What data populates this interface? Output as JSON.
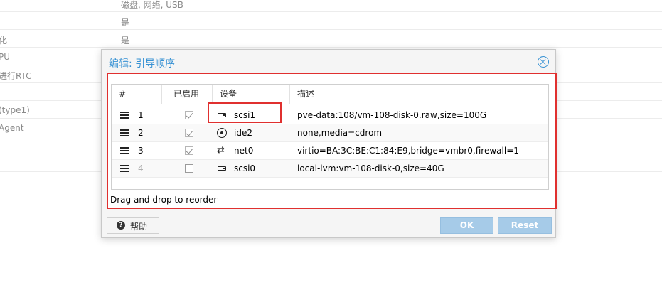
{
  "background": {
    "rows": [
      {
        "key": "",
        "value": "磁盘, 网络, USB"
      },
      {
        "key": "",
        "value": "是"
      },
      {
        "key": "化",
        "value": "是"
      },
      {
        "key": "PU",
        "value": ""
      },
      {
        "key": "进行RTC",
        "value": ""
      },
      {
        "key": "",
        "value": ""
      },
      {
        "key": "(type1)",
        "value": ""
      },
      {
        "key": "Agent",
        "value": ""
      },
      {
        "key": "",
        "value": ""
      },
      {
        "key": "",
        "value": ""
      }
    ]
  },
  "dialog": {
    "title": "编辑: 引导顺序",
    "columns": {
      "order": "#",
      "enabled": "已启用",
      "device": "设备",
      "description": "描述"
    },
    "rows": [
      {
        "order": "1",
        "enabled": true,
        "icon": "hdd-icon",
        "device": "scsi1",
        "description": "pve-data:108/vm-108-disk-0.raw,size=100G"
      },
      {
        "order": "2",
        "enabled": true,
        "icon": "cdrom-icon",
        "device": "ide2",
        "description": "none,media=cdrom"
      },
      {
        "order": "3",
        "enabled": true,
        "icon": "network-icon",
        "device": "net0",
        "description": "virtio=BA:3C:BE:C1:84:E9,bridge=vmbr0,firewall=1"
      },
      {
        "order": "4",
        "enabled": false,
        "icon": "hdd-icon",
        "device": "scsi0",
        "description": "local-lvm:vm-108-disk-0,size=40G"
      }
    ],
    "footer_hint": "Drag and drop to reorder",
    "buttons": {
      "help": "帮助",
      "ok": "OK",
      "reset": "Reset"
    }
  },
  "colors": {
    "accent": "#3892d4",
    "highlight": "#e0302f",
    "button_disabled": "#a6cbe8"
  }
}
